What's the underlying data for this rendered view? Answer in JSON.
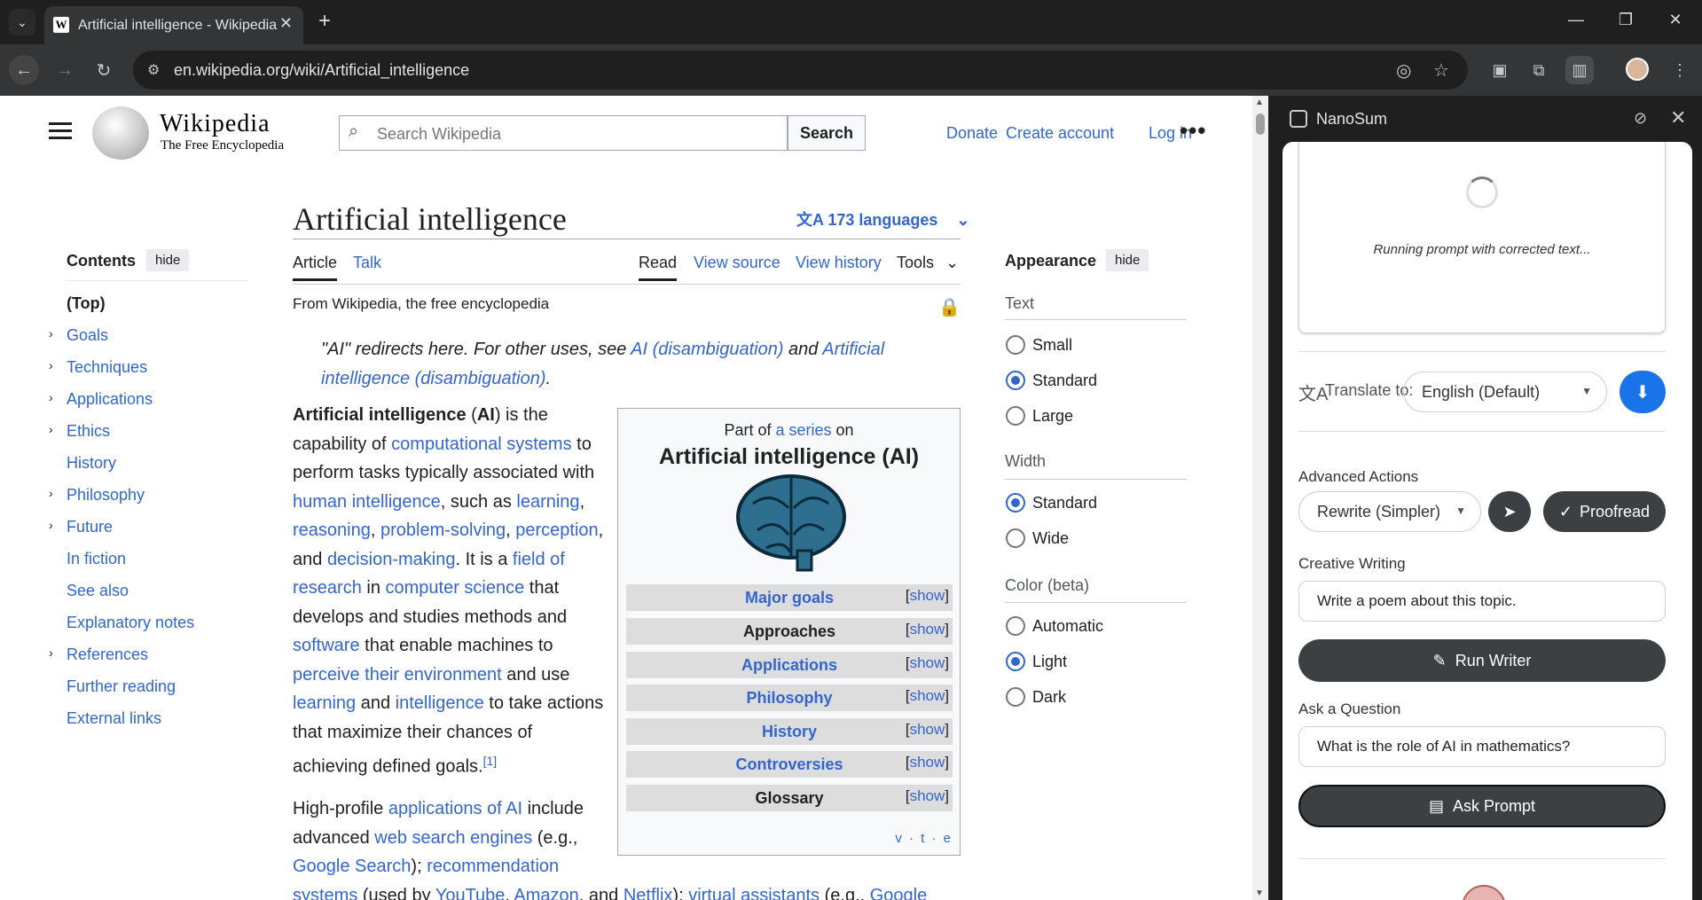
{
  "browser": {
    "tab_title": "Artificial intelligence - Wikipedia",
    "url": "en.wikipedia.org/wiki/Artificial_intelligence"
  },
  "wiki": {
    "wordmark": "Wikipedia",
    "tagline": "The Free Encyclopedia",
    "search_placeholder": "Search Wikipedia",
    "search_button": "Search",
    "donate": "Donate",
    "create_account": "Create account",
    "log_in": "Log in",
    "contents": {
      "heading": "Contents",
      "hide": "hide",
      "items": [
        "(Top)",
        "Goals",
        "Techniques",
        "Applications",
        "Ethics",
        "History",
        "Philosophy",
        "Future",
        "In fiction",
        "See also",
        "Explanatory notes",
        "References",
        "Further reading",
        "External links"
      ]
    },
    "title": "Artificial intelligence",
    "languages": "173 languages",
    "tabs": {
      "article": "Article",
      "talk": "Talk",
      "read": "Read",
      "view_source": "View source",
      "view_history": "View history",
      "tools": "Tools"
    },
    "from": "From Wikipedia, the free encyclopedia",
    "hatnote": {
      "pre": "\"AI\" redirects here. For other uses, see ",
      "link1": "AI (disambiguation)",
      "mid": " and ",
      "link2": "Artificial intelligence (disambiguation)",
      "end": "."
    },
    "infobox": {
      "part_pre": "Part of ",
      "part_link": "a series",
      "part_post": " on",
      "title": "Artificial intelligence (AI)",
      "rows": [
        {
          "label": "Major goals",
          "link": true
        },
        {
          "label": "Approaches",
          "link": false
        },
        {
          "label": "Applications",
          "link": true
        },
        {
          "label": "Philosophy",
          "link": true
        },
        {
          "label": "History",
          "link": true
        },
        {
          "label": "Controversies",
          "link": true
        },
        {
          "label": "Glossary",
          "link": false
        }
      ],
      "show": "show",
      "vte": "v · t · e"
    },
    "appearance": {
      "heading": "Appearance",
      "hide": "hide",
      "text_label": "Text",
      "text_options": [
        "Small",
        "Standard",
        "Large"
      ],
      "text_selected": "Standard",
      "width_label": "Width",
      "width_options": [
        "Standard",
        "Wide"
      ],
      "width_selected": "Standard",
      "color_label": "Color (beta)",
      "color_options": [
        "Automatic",
        "Light",
        "Dark"
      ],
      "color_selected": "Light"
    }
  },
  "panel": {
    "title": "NanoSum",
    "loading_text": "Running prompt with corrected text...",
    "translate_label": "Translate to:",
    "translate_value": "English (Default)",
    "advanced_heading": "Advanced Actions",
    "rewrite_value": "Rewrite (Simpler)",
    "proofread": "Proofread",
    "creative_heading": "Creative Writing",
    "creative_value": "Write a poem about this topic.",
    "run_writer": "Run Writer",
    "ask_heading": "Ask a Question",
    "ask_value": "What is the role of AI in mathematics?",
    "ask_prompt": "Ask Prompt"
  }
}
